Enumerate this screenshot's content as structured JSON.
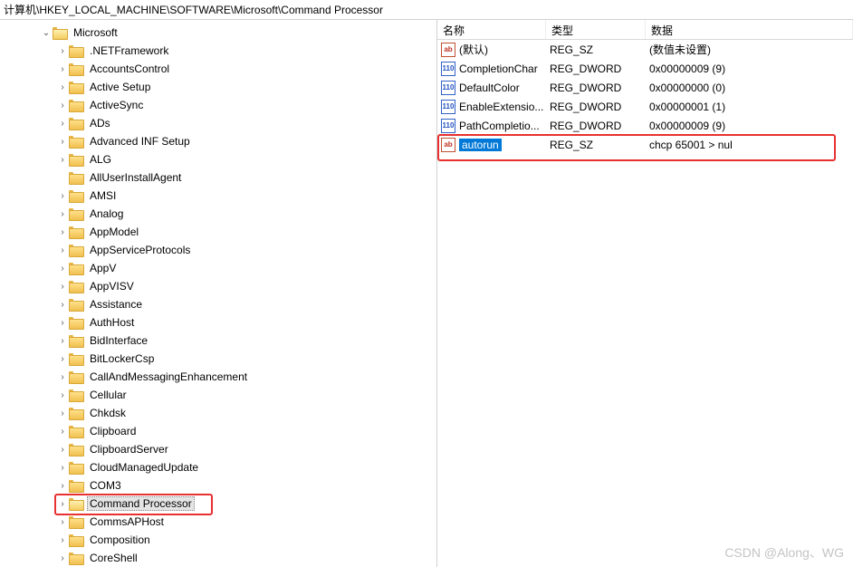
{
  "address_bar": "计算机\\HKEY_LOCAL_MACHINE\\SOFTWARE\\Microsoft\\Command Processor",
  "tree": {
    "root": {
      "label": "Microsoft",
      "expanded": true
    },
    "children": [
      ".NETFramework",
      "AccountsControl",
      "Active Setup",
      "ActiveSync",
      "ADs",
      "Advanced INF Setup",
      "ALG",
      "AllUserInstallAgent",
      "AMSI",
      "Analog",
      "AppModel",
      "AppServiceProtocols",
      "AppV",
      "AppVISV",
      "Assistance",
      "AuthHost",
      "BidInterface",
      "BitLockerCsp",
      "CallAndMessagingEnhancement",
      "Cellular",
      "Chkdsk",
      "Clipboard",
      "ClipboardServer",
      "CloudManagedUpdate",
      "COM3",
      "Command Processor",
      "CommsAPHost",
      "Composition",
      "CoreShell"
    ],
    "no_expand": [
      "AllUserInstallAgent"
    ],
    "selected": "Command Processor"
  },
  "columns": {
    "name": "名称",
    "type": "类型",
    "data": "数据"
  },
  "values": [
    {
      "name": "(默认)",
      "vtype": "REG_SZ",
      "data": "(数值未设置)",
      "kind": "string"
    },
    {
      "name": "CompletionChar",
      "vtype": "REG_DWORD",
      "data": "0x00000009 (9)",
      "kind": "dword"
    },
    {
      "name": "DefaultColor",
      "vtype": "REG_DWORD",
      "data": "0x00000000 (0)",
      "kind": "dword"
    },
    {
      "name": "EnableExtensio...",
      "vtype": "REG_DWORD",
      "data": "0x00000001 (1)",
      "kind": "dword"
    },
    {
      "name": "PathCompletio...",
      "vtype": "REG_DWORD",
      "data": "0x00000009 (9)",
      "kind": "dword"
    },
    {
      "name": "autorun",
      "vtype": "REG_SZ",
      "data": "chcp 65001 > nul",
      "kind": "string",
      "selected": true
    }
  ],
  "watermark": "CSDN @Along、WG"
}
